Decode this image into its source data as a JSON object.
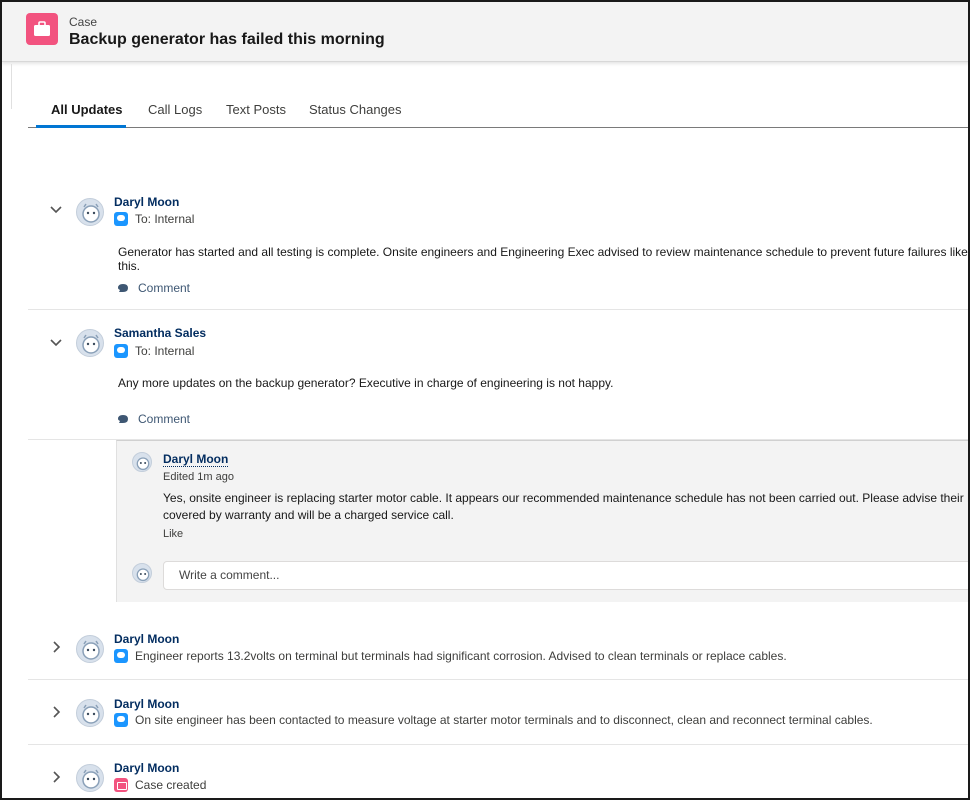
{
  "header": {
    "object_label": "Case",
    "record_title": "Backup generator has failed this morning"
  },
  "tabs": [
    {
      "label": "All Updates"
    },
    {
      "label": "Call Logs"
    },
    {
      "label": "Text Posts"
    },
    {
      "label": "Status Changes"
    }
  ],
  "feed": [
    {
      "author": "Daryl Moon",
      "audience": "To: Internal",
      "text": "Generator has started and all testing is complete. Onsite engineers and Engineering Exec advised to review maintenance schedule to prevent future failures like this.",
      "comment_label": "Comment"
    },
    {
      "author": "Samantha Sales",
      "audience": "To: Internal",
      "text": "Any more updates on the backup generator? Executive in charge of engineering is not happy.",
      "comment_label": "Comment"
    },
    {
      "author": "Daryl Moon",
      "summary": "Engineer reports 13.2volts on terminal but terminals had significant corrosion. Advised to clean terminals or replace cables."
    },
    {
      "author": "Daryl Moon",
      "summary": "On site engineer has been contacted to measure voltage at starter motor terminals and to disconnect, clean and reconnect terminal cables."
    },
    {
      "author": "Daryl Moon",
      "summary": "Case created"
    }
  ],
  "reply": {
    "author": "Daryl Moon",
    "edited": "Edited 1m ago",
    "line1": "Yes, onsite engineer is replacing starter motor cable. It appears our recommended maintenance schedule has not been carried out. Please advise their Engineer",
    "line2": "covered by warranty and will be a charged service call.",
    "like_label": "Like",
    "comment_placeholder": "Write a comment..."
  },
  "colors": {
    "accent": "#0176d3",
    "case_icon": "#f2537f",
    "post_badge": "#1b96ff",
    "author_link": "#032d60"
  },
  "icons": {
    "case": "briefcase-icon",
    "expanded": "chevron-down-icon",
    "collapsed": "chevron-right-icon",
    "post": "chat-bubble-icon",
    "comment": "comment-icon",
    "avatar": "astro-avatar"
  }
}
